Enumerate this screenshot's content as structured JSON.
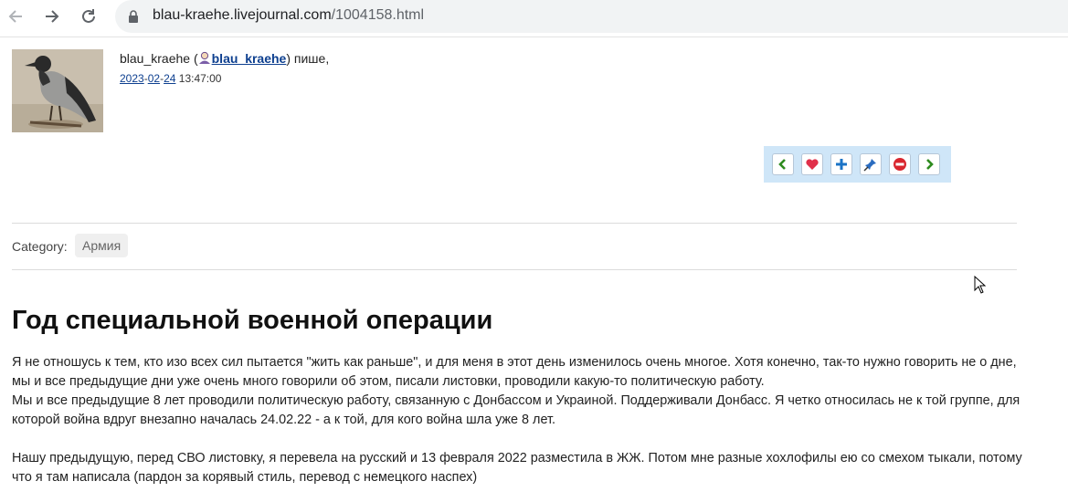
{
  "browser": {
    "url_domain": "blau-kraehe.livejournal.com",
    "url_path": "/1004158.html"
  },
  "entry": {
    "author_name": "blau_kraehe",
    "author_open": " (",
    "author_username": "blau_kraehe",
    "author_close": ") пише,",
    "date_year": "2023",
    "date_month": "02",
    "date_day": "24",
    "date_time": "13:47:00",
    "category_label": "Category:",
    "category_tag": "Армия",
    "title": "Год специальной военной операции",
    "paragraphs": [
      "Я не отношусь к тем, кто изо всех сил пытается \"жить как раньше\", и для меня в этот день изменилось очень многое. Хотя конечно, так-то нужно говорить не о дне, мы и все предыдущие дни уже очень много говорили об этом, писали листовки, проводили какую-то политическую работу.",
      "Мы и все предыдущие 8 лет проводили политическую работу, связанную с Донбассом и Украиной. Поддерживали Донбасс. Я четко относилась не к той группе, для которой война вдруг внезапно началась 24.02.22 - а к той, для кого война шла уже 8 лет.",
      "Нашу предыдущую, перед СВО листовку, я перевела на русский и 13 февраля 2022 разместила в ЖЖ. Потом мне разные хохлофилы ею со смехом тыкали, потому что я там  написала (пардон за корявый стиль, перевод с немецкого наспех)"
    ]
  },
  "toolbar_icons": [
    "prev-icon",
    "heart-icon",
    "plus-icon",
    "pin-icon",
    "minus-icon",
    "next-icon"
  ],
  "colors": {
    "link": "#0d3f8f",
    "toolbar_bg": "#cfe6f8"
  }
}
